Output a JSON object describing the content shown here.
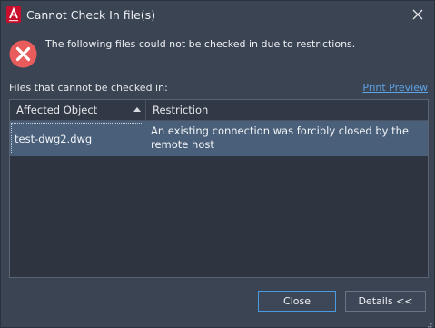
{
  "window": {
    "title": "Cannot Check In file(s)",
    "app_icon": "autocad-logo-icon",
    "close_icon": "close-icon"
  },
  "message": {
    "icon": "error-icon",
    "icon_color": "#e85c5c",
    "text": "The following files could not be checked in due to restrictions."
  },
  "list": {
    "label": "Files that cannot be checked in:",
    "print_preview": "Print Preview",
    "columns": [
      "Affected Object",
      "Restriction"
    ],
    "sort_icon": "sort-ascending-icon",
    "rows": [
      {
        "affected_object": "test-dwg2.dwg",
        "restriction": "An existing connection was forcibly closed by the remote host"
      }
    ]
  },
  "buttons": {
    "close": "Close",
    "details": "Details <<"
  },
  "colors": {
    "background": "#3b4453",
    "grid_background": "#2e3440",
    "selected_row": "#4a607a",
    "link": "#5ea3e6",
    "accent_border": "#4a9ae0",
    "brand_red": "#c8102e"
  }
}
